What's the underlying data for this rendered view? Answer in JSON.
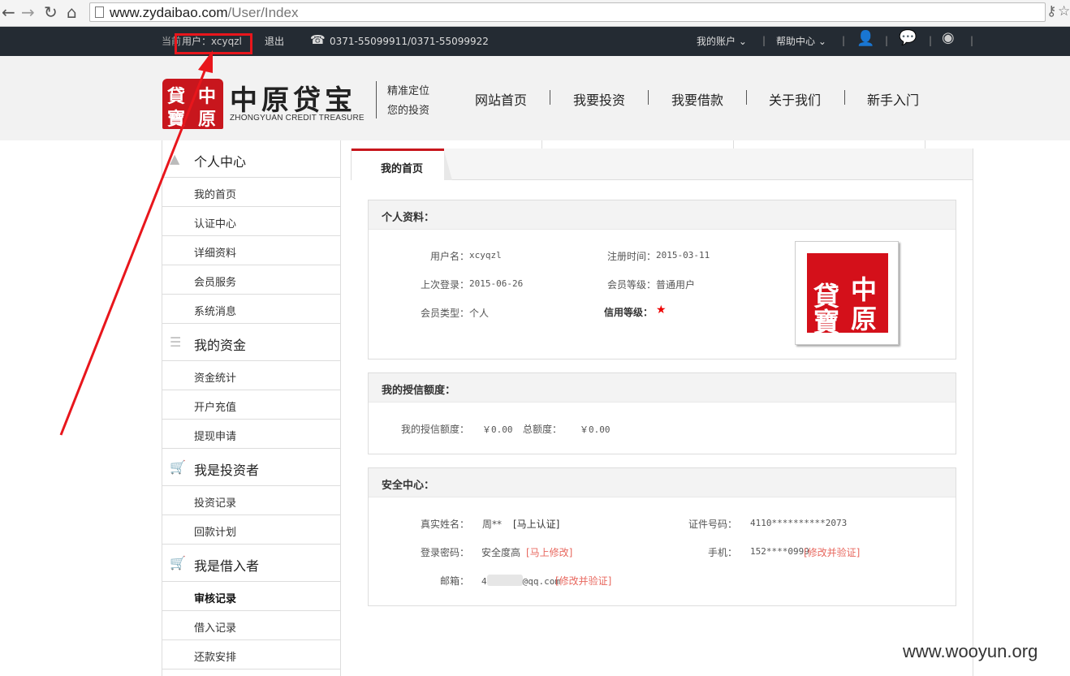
{
  "browser": {
    "url_host": "www.zydaibao.com",
    "url_path": "/User/Index"
  },
  "topbar": {
    "current_user_prefix": "当前",
    "current_user_label": "用户：xcyqzl",
    "logout": "退出",
    "phone": "0371-55099911/0371-55099922",
    "my_account": "我的账户",
    "help_center": "帮助中心"
  },
  "header": {
    "seal_chars": [
      "貸",
      "中",
      "寶",
      "原"
    ],
    "logo_title": "中原贷宝",
    "logo_sub": "ZHONGYUAN CREDIT TREASURE",
    "slogan_1": "精准定位",
    "slogan_2": "您的投资",
    "nav": [
      "网站首页",
      "我要投资",
      "我要借款",
      "关于我们",
      "新手入门"
    ]
  },
  "sidebar": {
    "groups": [
      {
        "label": "个人中心",
        "items": [
          "我的首页",
          "认证中心",
          "详细资料",
          "会员服务",
          "系统消息"
        ]
      },
      {
        "label": "我的资金",
        "items": [
          "资金统计",
          "开户充值",
          "提现申请"
        ]
      },
      {
        "label": "我是投资者",
        "items": [
          "投资记录",
          "回款计划"
        ]
      },
      {
        "label": "我是借入者",
        "items": [
          "审核记录",
          "借入记录",
          "还款安排"
        ]
      }
    ]
  },
  "tab": {
    "active": "我的首页"
  },
  "profile": {
    "title": "个人资料：",
    "username_label": "用户名：",
    "username": "xcyqzl",
    "reg_label": "注册时间：",
    "reg_date": "2015-03-11",
    "last_login_label": "上次登录：",
    "last_login": "2015-06-26",
    "level_label": "会员等级：",
    "level": "普通用户",
    "type_label": "会员类型：",
    "type": "个人",
    "credit_label": "信用等级：",
    "credit_star": "★"
  },
  "credit": {
    "title": "我的授信额度：",
    "limit_label": "我的授信额度：",
    "limit": "￥0.00",
    "total_label": "总额度：",
    "total": "￥0.00"
  },
  "security": {
    "title": "安全中心：",
    "realname_label": "真实姓名：",
    "realname": "周**",
    "realname_action": "[马上认证]",
    "id_label": "证件号码：",
    "id_number": "4110**********2073",
    "pwd_label": "登录密码：",
    "pwd_value": "安全度高",
    "pwd_action": "[马上修改]",
    "phone_label": "手机：",
    "phone": "152****0999",
    "phone_action": "[修改并验证]",
    "email_label": "邮箱：",
    "email_start": "4",
    "email_end": "@qq.com",
    "email_action": "[修改并验证]"
  },
  "watermark": "www.wooyun.org",
  "colors": {
    "accent_red": "#c8161d",
    "topbar": "#242b33",
    "link": "#e8685f",
    "annotation": "#e8161c"
  }
}
